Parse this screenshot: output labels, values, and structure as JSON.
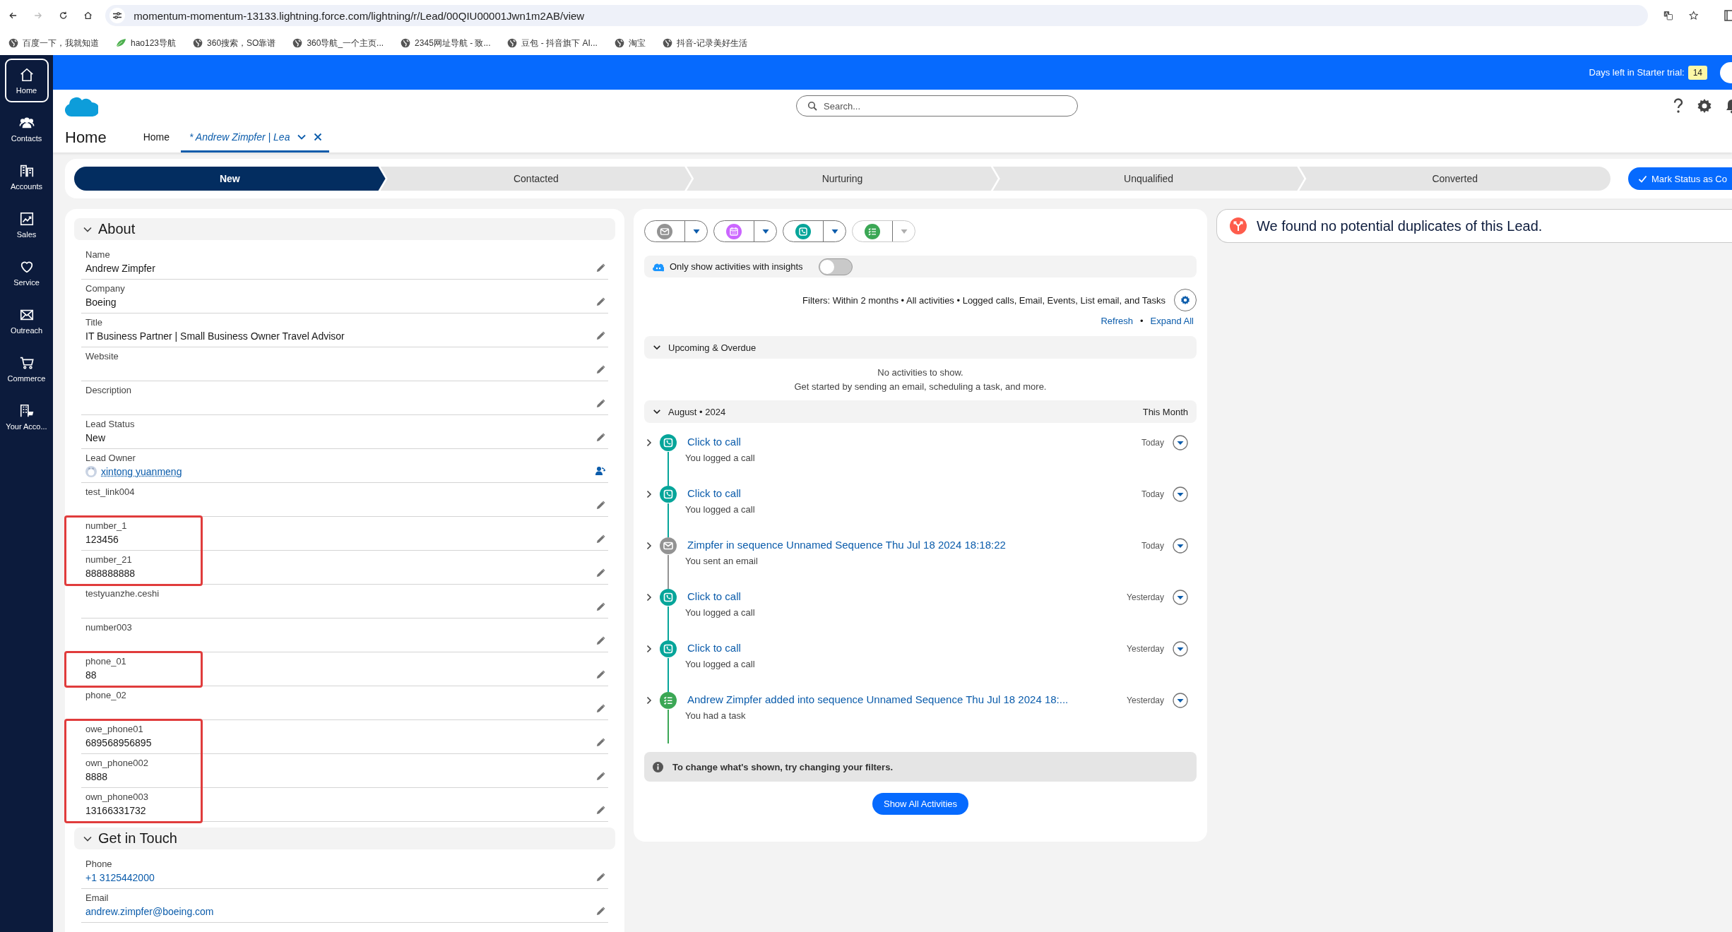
{
  "browser": {
    "nav_buttons": [
      {
        "kind": "back",
        "disabled": false
      },
      {
        "kind": "forward",
        "disabled": true
      },
      {
        "kind": "reload",
        "disabled": false
      },
      {
        "kind": "home",
        "disabled": false
      }
    ],
    "url": "momentum-momentum-13133.lightning.force.com/lightning/r/Lead/00QIU00001Jwn1m2AB/view",
    "bookmarks": [
      {
        "label": "百度一下，我就知道",
        "kind": "globe"
      },
      {
        "label": "hao123导航",
        "kind": "hao"
      },
      {
        "label": "360搜索，SO靠谱",
        "kind": "globe"
      },
      {
        "label": "360导航_一个主页...",
        "kind": "globe"
      },
      {
        "label": "2345网址导航 - 致...",
        "kind": "globe"
      },
      {
        "label": "豆包 - 抖音旗下 AI...",
        "kind": "globe"
      },
      {
        "label": "淘宝",
        "kind": "globe"
      },
      {
        "label": "抖音-记录美好生活",
        "kind": "globe"
      }
    ]
  },
  "nav": [
    {
      "label": "Home",
      "kind": "home",
      "selected": true
    },
    {
      "label": "Contacts",
      "kind": "contacts",
      "selected": false
    },
    {
      "label": "Accounts",
      "kind": "accounts",
      "selected": false
    },
    {
      "label": "Sales",
      "kind": "sales",
      "selected": false
    },
    {
      "label": "Service",
      "kind": "service",
      "selected": false
    },
    {
      "label": "Outreach",
      "kind": "outreach",
      "selected": false
    },
    {
      "label": "Commerce",
      "kind": "commerce",
      "selected": false
    },
    {
      "label": "Your Acco...",
      "kind": "account",
      "selected": false
    }
  ],
  "trial": {
    "label": "Days left in Starter trial:",
    "days": "14"
  },
  "search": {
    "placeholder": "Search..."
  },
  "app_title": "Home",
  "tabs": [
    {
      "label": "Home",
      "selected": false
    },
    {
      "label": "* Andrew Zimpfer | Lea",
      "selected": true
    }
  ],
  "path": {
    "steps": [
      {
        "label": "New",
        "selected": true
      },
      {
        "label": "Contacted",
        "selected": false
      },
      {
        "label": "Nurturing",
        "selected": false
      },
      {
        "label": "Unqualified",
        "selected": false
      },
      {
        "label": "Converted",
        "selected": false
      }
    ],
    "action": "Mark Status as Co"
  },
  "about": {
    "title": "About",
    "expanded": true,
    "fields": [
      {
        "label": "Name",
        "value": "Andrew Zimpfer",
        "kind": "text",
        "marked": false
      },
      {
        "label": "Company",
        "value": "Boeing",
        "kind": "text",
        "marked": false
      },
      {
        "label": "Title",
        "value": "IT Business Partner | Small Business Owner Travel Advisor",
        "kind": "text",
        "marked": false
      },
      {
        "label": "Website",
        "kind": "text",
        "marked": false
      },
      {
        "label": "Description",
        "kind": "text",
        "marked": false
      },
      {
        "label": "Lead Status",
        "value": "New",
        "kind": "text",
        "marked": false
      },
      {
        "label": "Lead Owner",
        "value": "xintong yuanmeng",
        "kind": "user",
        "marked": false
      },
      {
        "label": "test_link004",
        "kind": "text",
        "marked": false
      },
      {
        "label": "number_1",
        "value": "123456",
        "kind": "text",
        "marked": true
      },
      {
        "label": "number_21",
        "value": "888888888",
        "kind": "text",
        "marked": true
      },
      {
        "label": "testyuanzhe.ceshi",
        "kind": "text",
        "marked": false
      },
      {
        "label": "number003",
        "kind": "text",
        "marked": false
      },
      {
        "label": "phone_01",
        "value": "88",
        "kind": "text",
        "marked": true
      },
      {
        "label": "phone_02",
        "kind": "text",
        "marked": false
      },
      {
        "label": "owe_phone01",
        "value": "689568956895",
        "kind": "text",
        "marked": true
      },
      {
        "label": "own_phone002",
        "value": "8888",
        "kind": "text",
        "marked": true
      },
      {
        "label": "own_phone003",
        "value": "13166331732",
        "kind": "text",
        "marked": true
      }
    ]
  },
  "get_in_touch": {
    "title": "Get in Touch",
    "expanded": true,
    "fields": [
      {
        "label": "Phone",
        "value": "+1 3125442000",
        "kind": "link",
        "marked": false
      },
      {
        "label": "Email",
        "value": "andrew.zimpfer@boeing.com",
        "kind": "link",
        "marked": false
      }
    ]
  },
  "activity": {
    "composer": [
      {
        "kind": "email",
        "menu_disabled": false
      },
      {
        "kind": "event",
        "menu_disabled": false
      },
      {
        "kind": "call",
        "menu_disabled": false
      },
      {
        "kind": "task",
        "menu_disabled": true
      }
    ],
    "insights": {
      "label": "Only show activities with insights",
      "on": false
    },
    "filters": "Filters: Within 2 months • All activities • Logged calls, Email, Events, List email, and Tasks",
    "links": [
      "Refresh",
      "Expand All"
    ],
    "separator": "•",
    "upcoming": {
      "title": "Upcoming & Overdue",
      "expanded": true,
      "empty_lines": [
        "No activities to show.",
        "Get started by sending an email, scheduling a task, and more."
      ]
    },
    "month": {
      "title": "August • 2024",
      "note": "This Month",
      "expanded": true,
      "items": [
        {
          "kind": "call",
          "title": "Click to call",
          "subtitle": "You logged a call",
          "date": "Today"
        },
        {
          "kind": "call",
          "title": "Click to call",
          "subtitle": "You logged a call",
          "date": "Today"
        },
        {
          "kind": "email",
          "title": "Zimpfer in sequence Unnamed Sequence Thu Jul 18 2024 18:18:22",
          "subtitle": "You sent an email",
          "date": "Today"
        },
        {
          "kind": "call",
          "title": "Click to call",
          "subtitle": "You logged a call",
          "date": "Yesterday"
        },
        {
          "kind": "call",
          "title": "Click to call",
          "subtitle": "You logged a call",
          "date": "Yesterday"
        },
        {
          "kind": "task",
          "title": "Andrew Zimpfer added into sequence Unnamed Sequence Thu Jul 18 2024 18:...",
          "subtitle": "You had a task",
          "date": "Yesterday"
        }
      ]
    },
    "banner": "To change what's shown, try changing your filters.",
    "show_all": "Show All Activities"
  },
  "duplicates": {
    "message": "We found no potential duplicates of this Lead."
  }
}
